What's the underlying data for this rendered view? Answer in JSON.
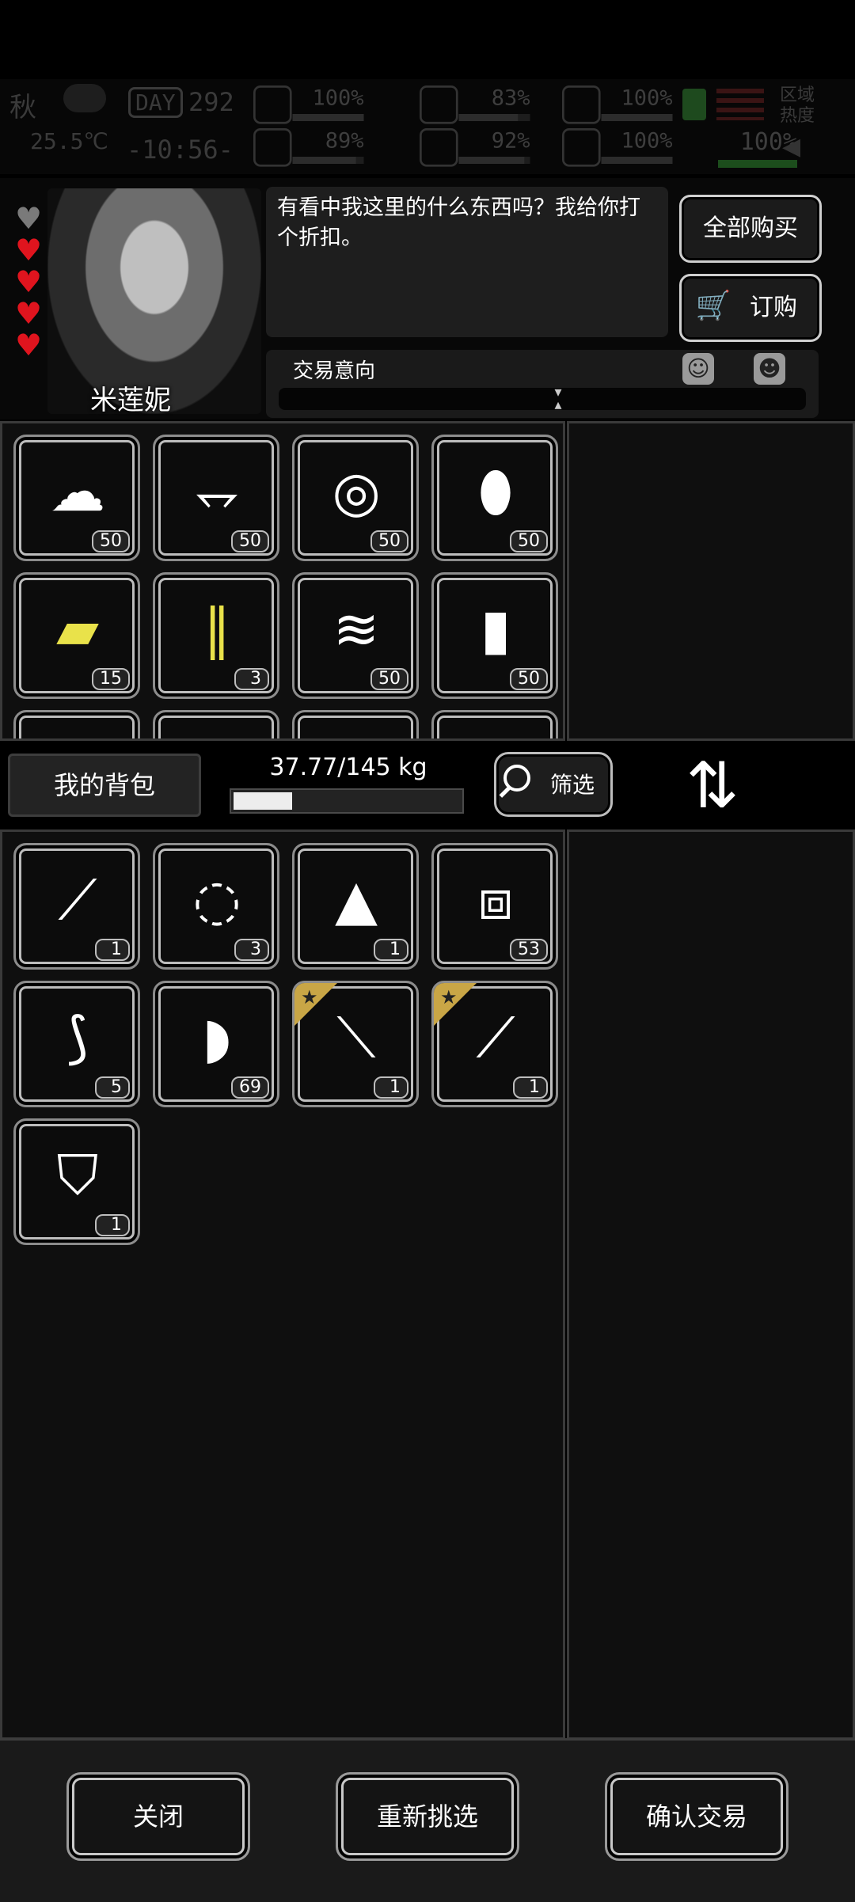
{
  "hud": {
    "season": "秋",
    "day_label": "DAY",
    "day": "292",
    "temperature": "25.5℃",
    "time": "-10:56-",
    "area_heat": "区域\n热度",
    "stats": [
      {
        "icon": "medkit-icon",
        "value": "100%",
        "fill": 1.0
      },
      {
        "icon": "stomach-icon",
        "value": "83%",
        "fill": 0.83
      },
      {
        "icon": "stamina-icon",
        "value": "100%",
        "fill": 1.0
      },
      {
        "icon": "brain-icon",
        "value": "89%",
        "fill": 0.89
      },
      {
        "icon": "water-drop-icon",
        "value": "92%",
        "fill": 0.92
      },
      {
        "icon": "heart-icon",
        "value": "100%",
        "fill": 1.0
      }
    ],
    "extra_stat": {
      "value": "100%",
      "fill": 1.0
    }
  },
  "npc": {
    "name": "米莲妮",
    "hearts": [
      {
        "color": "#7a7a7a"
      },
      {
        "color": "#e0141e"
      },
      {
        "color": "#e0141e"
      },
      {
        "color": "#e0141e"
      },
      {
        "color": "#e0141e"
      }
    ],
    "dialog": "有看中我这里的什么东西吗？我给你打个折扣。",
    "buy_all": "全部购买",
    "order": "订购",
    "trade_intent_label": "交易意向",
    "trade_intent_level": 0.53
  },
  "shop_items": [
    {
      "icon": "cloth-pile-icon",
      "glyph": "☁",
      "count": "50"
    },
    {
      "icon": "scrap-cloth-icon",
      "glyph": "⥐",
      "count": "50"
    },
    {
      "icon": "logs-icon",
      "glyph": "◎",
      "count": "50"
    },
    {
      "icon": "plastic-bottle-icon",
      "glyph": "⬮",
      "count": "50"
    },
    {
      "icon": "yellow-fabric-icon",
      "glyph": "▰",
      "count": "15",
      "color": "#e9e24a"
    },
    {
      "icon": "safety-pin-icon",
      "glyph": "∥",
      "count": "3",
      "color": "#e9e24a"
    },
    {
      "icon": "tape-roll-icon",
      "glyph": "≋",
      "count": "50"
    },
    {
      "icon": "battery-icon",
      "glyph": "▮",
      "count": "50"
    }
  ],
  "bag": {
    "label": "我的背包",
    "weight": "37.77/145 kg",
    "weight_fraction": 0.26,
    "filter_label": "筛选"
  },
  "bag_items": [
    {
      "icon": "lockpick-icon",
      "glyph": "⟋",
      "count": "1"
    },
    {
      "icon": "rope-icon",
      "glyph": "◌",
      "count": "3"
    },
    {
      "icon": "torn-shirt-icon",
      "glyph": "▲",
      "count": "1"
    },
    {
      "icon": "spray-cans-icon",
      "glyph": "⧈",
      "count": "53"
    },
    {
      "icon": "bandage-splint-icon",
      "glyph": "⟆",
      "count": "5"
    },
    {
      "icon": "bandage-roll-icon",
      "glyph": "◗",
      "count": "69"
    },
    {
      "icon": "knife-icon",
      "glyph": "⟍",
      "count": "1",
      "starred": true
    },
    {
      "icon": "shovel-icon",
      "glyph": "⟋",
      "count": "1",
      "starred": true
    },
    {
      "icon": "armor-vest-icon",
      "glyph": "⛉",
      "count": "1"
    }
  ],
  "actions": {
    "close": "关闭",
    "reselect": "重新挑选",
    "confirm": "确认交易"
  }
}
